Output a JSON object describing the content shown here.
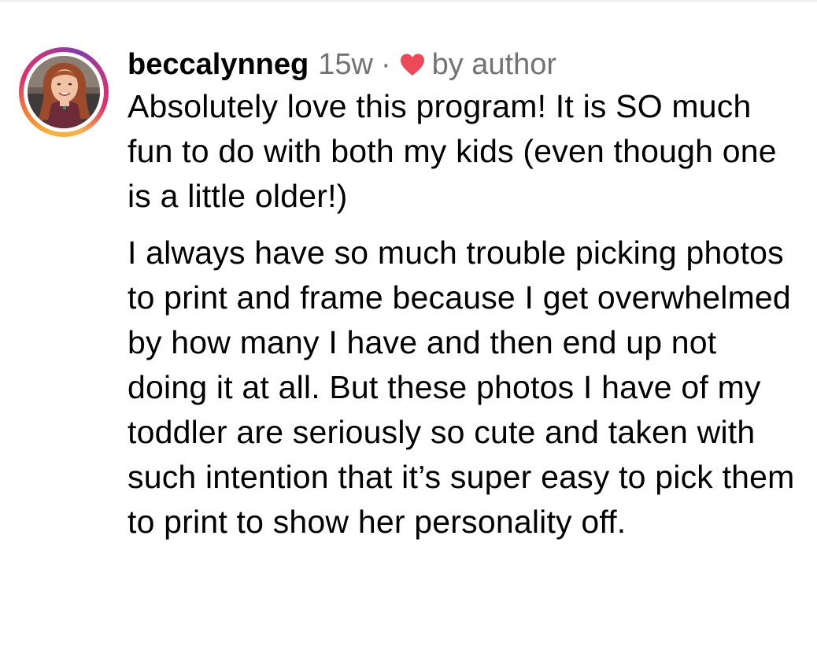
{
  "comment": {
    "username": "beccalynneg",
    "timestamp": "15w",
    "separator": "·",
    "liked_by_author_icon": "heart-icon",
    "liked_by_author_color": "#ed4956",
    "liked_by_author_text": "by author",
    "paragraphs": [
      "Absolutely love this program! It is SO much fun to do with both my kids (even though one is a little older!)",
      "I always have so much trouble picking photos to print and frame because I get overwhelmed by how many I have and then end up not doing it at all. But these photos I have of my toddler are seriously so cute and taken with such intention that it’s super easy to pick them to print to show her personality off."
    ]
  },
  "colors": {
    "meta_gray": "#737373",
    "story_ring_gradient": [
      "#f9b233",
      "#f77737",
      "#e1306c",
      "#c13584",
      "#833ab4"
    ]
  }
}
